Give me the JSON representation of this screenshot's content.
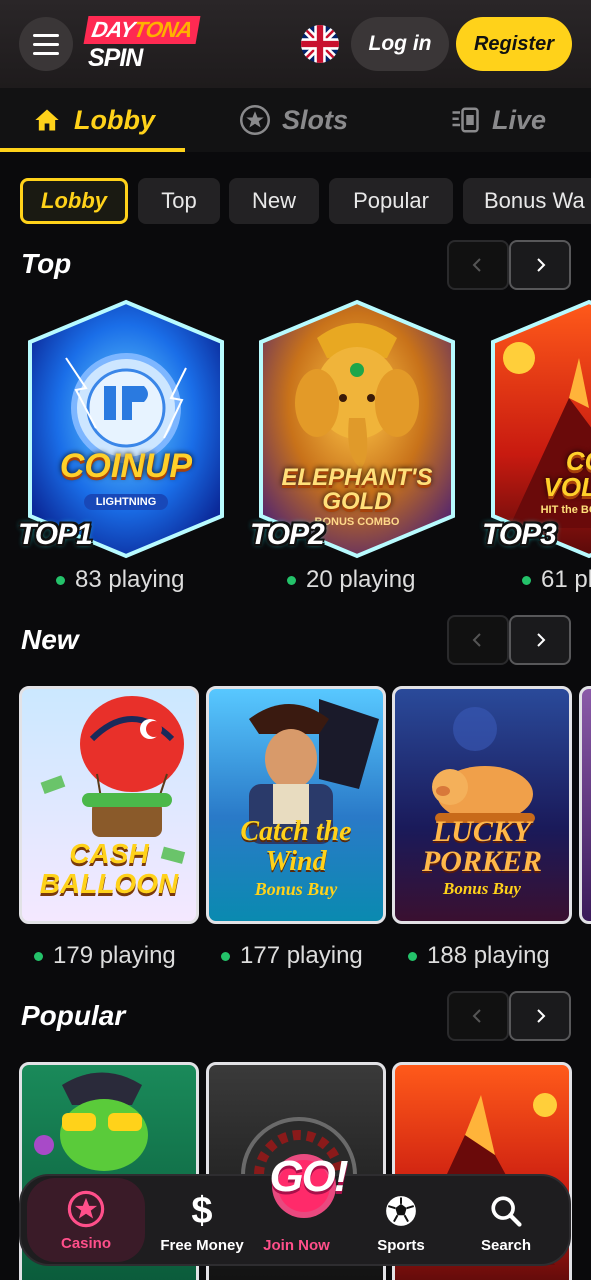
{
  "header": {
    "logo_line1_a": "DAY",
    "logo_line1_b": "TONA",
    "logo_line2": "SPIN",
    "login_label": "Log in",
    "register_label": "Register"
  },
  "main_tabs": [
    {
      "label": "Lobby",
      "icon": "home-icon",
      "active": true
    },
    {
      "label": "Slots",
      "icon": "star-icon",
      "active": false
    },
    {
      "label": "Live",
      "icon": "live-icon",
      "active": false
    }
  ],
  "chips": [
    {
      "label": "Lobby",
      "active": true
    },
    {
      "label": "Top",
      "active": false
    },
    {
      "label": "New",
      "active": false
    },
    {
      "label": "Popular",
      "active": false
    },
    {
      "label": "Bonus Wa",
      "active": false
    }
  ],
  "sections": {
    "top": {
      "title": "Top",
      "games": [
        {
          "name_line1": "COIN",
          "name_line2": "UP",
          "sub": "LIGHTNING",
          "badge": "TOP1",
          "playing": "83 playing"
        },
        {
          "name_line1": "ELEPHANT'S",
          "name_line2": "GOLD",
          "sub": "BONUS COMBO",
          "badge": "TOP2",
          "playing": "20 playing"
        },
        {
          "name_line1": "COI",
          "name_line2": "VOLCA",
          "sub": "HIT the BO",
          "badge": "TOP3",
          "playing": "61 pl"
        }
      ]
    },
    "new": {
      "title": "New",
      "games": [
        {
          "name_line1": "CASH",
          "name_line2": "BALLOON",
          "sub": "",
          "playing": "179 playing"
        },
        {
          "name_line1": "Catch the",
          "name_line2": "Wind",
          "sub": "Bonus Buy",
          "playing": "177 playing"
        },
        {
          "name_line1": "LUCKY",
          "name_line2": "PORKER",
          "sub": "Bonus Buy",
          "playing": "188 playing"
        }
      ]
    },
    "popular": {
      "title": "Popular"
    }
  },
  "bottom_nav": [
    {
      "label": "Casino",
      "icon": "casino-star-icon",
      "active": true
    },
    {
      "label": "Free Money",
      "icon": "dollar-icon",
      "active": false
    },
    {
      "label": "Join Now",
      "icon": "go-icon",
      "active": false
    },
    {
      "label": "Sports",
      "icon": "soccer-ball-icon",
      "active": false
    },
    {
      "label": "Search",
      "icon": "search-icon",
      "active": false
    }
  ],
  "go_label": "GO!",
  "colors": {
    "accent": "#ffd21a",
    "active_nav": "#ff4f8a",
    "online_dot": "#24c26a",
    "glow": "#22e0e0"
  }
}
